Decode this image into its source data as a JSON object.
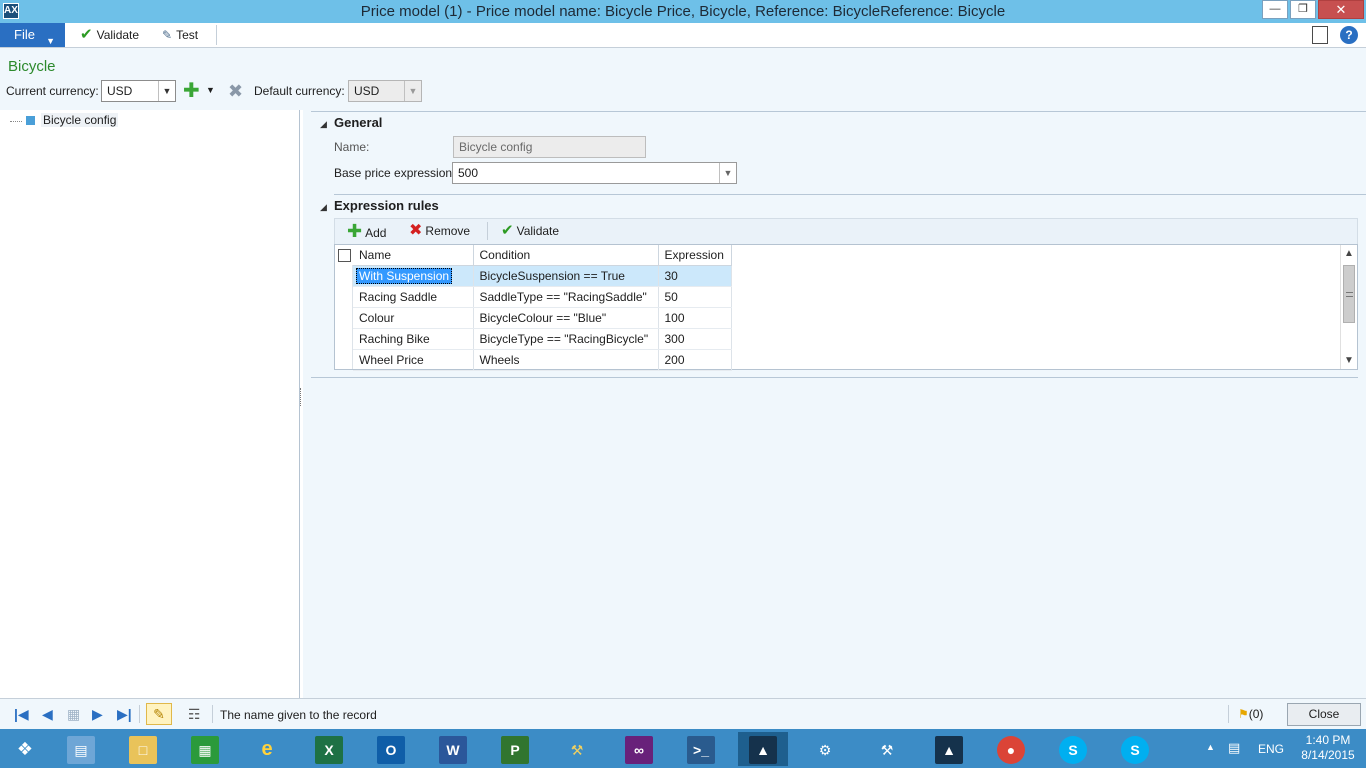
{
  "window": {
    "title": "Price model (1) - Price model name: Bicycle Price, Bicycle, Reference: BicycleReference: Bicycle",
    "app_icon": "dynamics-ax-icon"
  },
  "ribbon": {
    "file_label": "File",
    "validate_label": "Validate",
    "test_label": "Test"
  },
  "header": {
    "record_name": "Bicycle",
    "current_currency_label": "Current currency:",
    "current_currency_value": "USD",
    "default_currency_label": "Default currency:",
    "default_currency_value": "USD"
  },
  "tree": {
    "nodes": [
      {
        "label": "Bicycle config"
      }
    ]
  },
  "general": {
    "heading": "General",
    "name_label": "Name:",
    "name_value": "Bicycle config",
    "base_price_label": "Base price expression:",
    "base_price_value": "500"
  },
  "expression_rules": {
    "heading": "Expression rules",
    "toolbar": {
      "add_label": "Add",
      "remove_label": "Remove",
      "validate_label": "Validate"
    },
    "columns": [
      "Name",
      "Condition",
      "Expression"
    ],
    "rows": [
      {
        "name": "With Suspension",
        "condition": "BicycleSuspension == True",
        "expression": "30"
      },
      {
        "name": "Racing Saddle",
        "condition": "SaddleType == \"RacingSaddle\"",
        "expression": "50"
      },
      {
        "name": "Colour",
        "condition": "BicycleColour == \"Blue\"",
        "expression": "100"
      },
      {
        "name": "Raching Bike",
        "condition": "BicycleType == \"RacingBicycle\"",
        "expression": "300"
      },
      {
        "name": "Wheel Price",
        "condition": "Wheels",
        "expression": "200"
      }
    ]
  },
  "statusbar": {
    "help_text": "The name given to the record",
    "notifications": "(0)",
    "close_label": "Close"
  },
  "taskbar": {
    "language": "ENG",
    "time": "1:40 PM",
    "date": "8/14/2015"
  },
  "colors": {
    "titlebar": "#6ec0e8",
    "accent": "#2a6fc2",
    "record_name": "#2d8a2d",
    "taskbar": "#3c8cc6",
    "selection": "#3399ff"
  }
}
